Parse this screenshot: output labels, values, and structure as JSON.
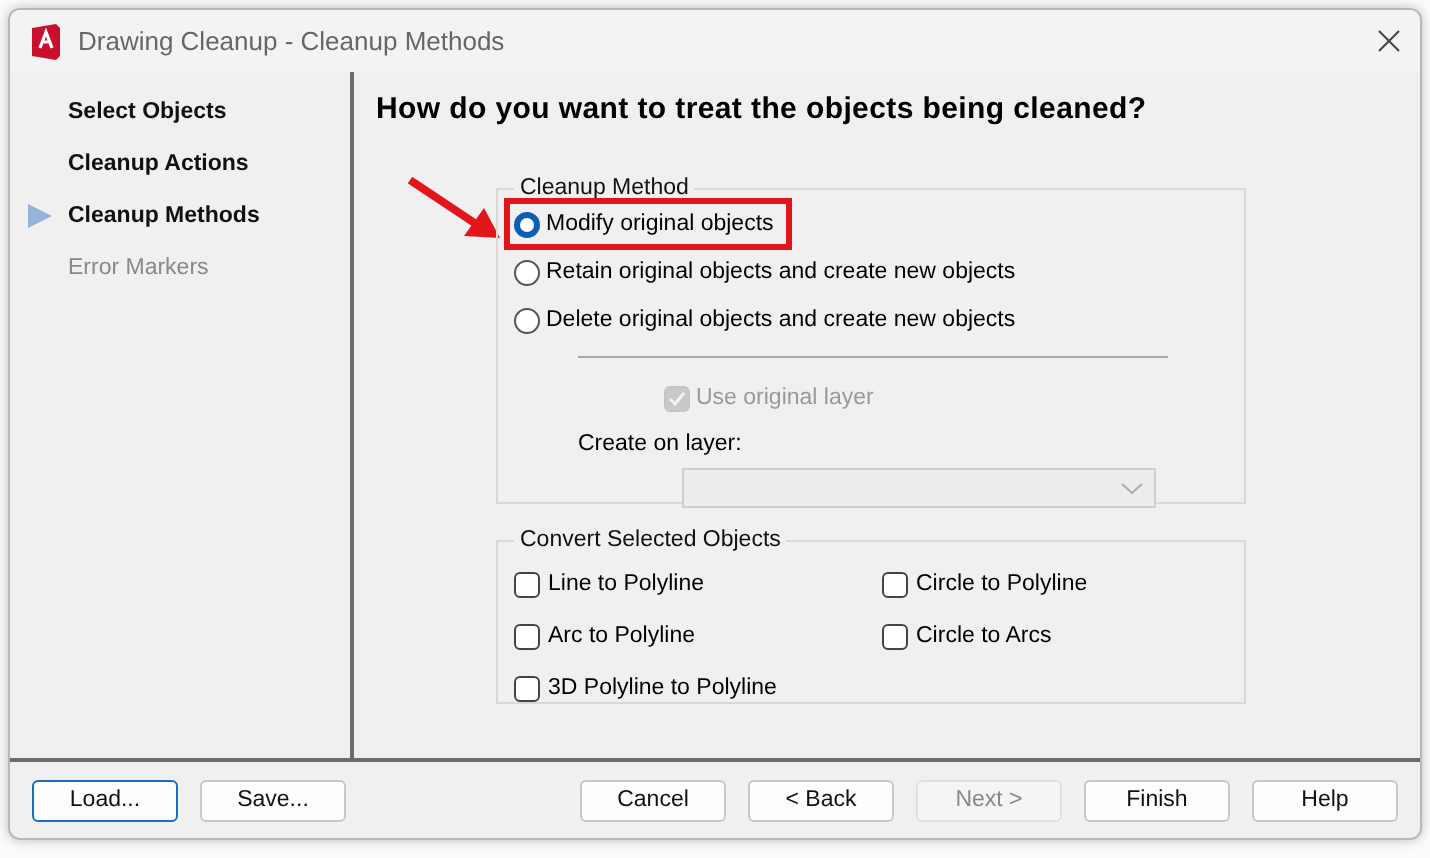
{
  "window": {
    "title": "Drawing Cleanup - Cleanup Methods"
  },
  "sidebar": {
    "items": [
      {
        "label": "Select Objects",
        "selected": false,
        "disabled": false
      },
      {
        "label": "Cleanup Actions",
        "selected": false,
        "disabled": false
      },
      {
        "label": "Cleanup Methods",
        "selected": true,
        "disabled": false
      },
      {
        "label": "Error Markers",
        "selected": false,
        "disabled": true
      }
    ]
  },
  "heading": "How do you want to treat the objects being cleaned?",
  "cleanup_method": {
    "title": "Cleanup Method",
    "options": [
      {
        "label": "Modify original objects",
        "selected": true,
        "highlighted": true
      },
      {
        "label": "Retain original objects and create new objects",
        "selected": false,
        "highlighted": false
      },
      {
        "label": "Delete original objects and create new objects",
        "selected": false,
        "highlighted": false
      }
    ],
    "use_original_layer": {
      "label": "Use original layer",
      "checked": true,
      "disabled": true
    },
    "create_on_layer": {
      "label": "Create on layer:",
      "disabled": true
    }
  },
  "convert": {
    "title": "Convert Selected Objects",
    "options": [
      {
        "label": "Line to Polyline",
        "checked": false
      },
      {
        "label": "Circle to Polyline",
        "checked": false
      },
      {
        "label": "Arc to Polyline",
        "checked": false
      },
      {
        "label": "Circle to Arcs",
        "checked": false
      },
      {
        "label": "3D Polyline to Polyline",
        "checked": false
      }
    ]
  },
  "left_buttons": [
    {
      "label": "Load...",
      "focused": true,
      "disabled": false
    },
    {
      "label": "Save...",
      "focused": false,
      "disabled": false
    }
  ],
  "right_buttons": [
    {
      "label": "Cancel",
      "focused": false,
      "disabled": false
    },
    {
      "label": "< Back",
      "focused": false,
      "disabled": false
    },
    {
      "label": "Next >",
      "focused": false,
      "disabled": true
    },
    {
      "label": "Finish",
      "focused": false,
      "disabled": false
    },
    {
      "label": "Help",
      "focused": false,
      "disabled": false
    }
  ]
}
